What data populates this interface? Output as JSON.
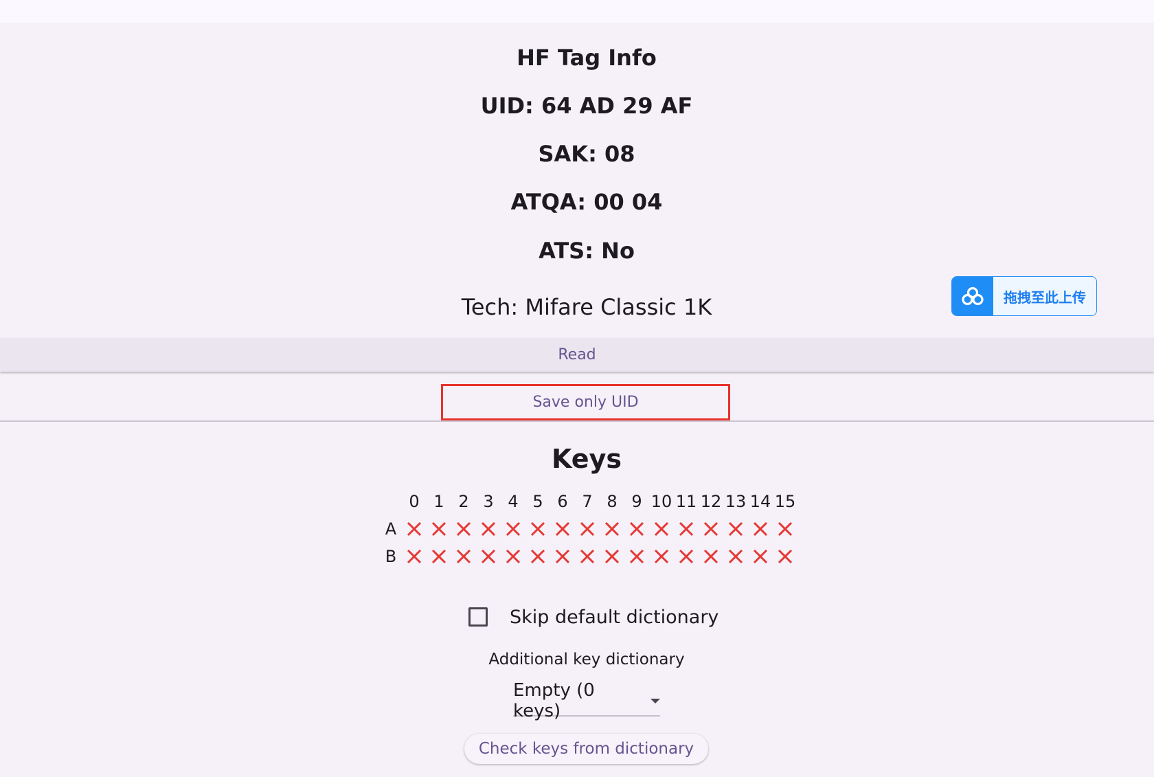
{
  "header": {
    "title": "HF Tag Info"
  },
  "tag_info": {
    "uid": "UID: 64 AD 29 AF",
    "sak": "SAK: 08",
    "atqa": "ATQA: 00 04",
    "ats": "ATS: No",
    "tech": "Tech: Mifare Classic 1K"
  },
  "actions": {
    "read_label": "Read",
    "save_uid_label": "Save only UID"
  },
  "keys": {
    "title": "Keys",
    "columns": [
      "0",
      "1",
      "2",
      "3",
      "4",
      "5",
      "6",
      "7",
      "8",
      "9",
      "10",
      "11",
      "12",
      "13",
      "14",
      "15"
    ],
    "rows": [
      {
        "label": "A",
        "status": [
          "missing",
          "missing",
          "missing",
          "missing",
          "missing",
          "missing",
          "missing",
          "missing",
          "missing",
          "missing",
          "missing",
          "missing",
          "missing",
          "missing",
          "missing",
          "missing"
        ]
      },
      {
        "label": "B",
        "status": [
          "missing",
          "missing",
          "missing",
          "missing",
          "missing",
          "missing",
          "missing",
          "missing",
          "missing",
          "missing",
          "missing",
          "missing",
          "missing",
          "missing",
          "missing",
          "missing"
        ]
      }
    ],
    "missing_icon": "cross-icon",
    "missing_color": "#e53935"
  },
  "options": {
    "skip_default_label": "Skip default dictionary",
    "skip_default_checked": false,
    "additional_dict_label": "Additional key dictionary",
    "dict_selected": "Empty (0 keys)",
    "check_keys_label": "Check keys from dictionary"
  },
  "upload_widget": {
    "label": "拖拽至此上传",
    "icon": "cloud-icon",
    "accent": "#1e8df5"
  },
  "colors": {
    "accent_text": "#65558f",
    "highlight_border": "#e8322c",
    "background": "#f6f1f8"
  }
}
